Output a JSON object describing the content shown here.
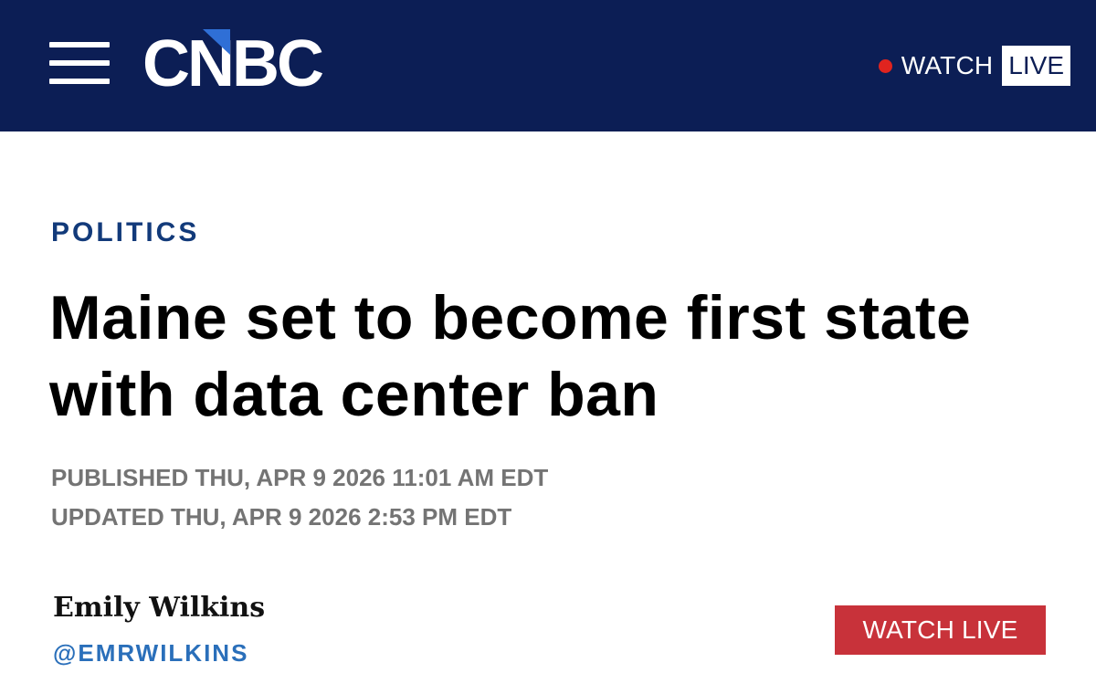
{
  "header": {
    "menu_icon": "hamburger-menu-icon",
    "logo_text": "CNBC",
    "watch_label": "WATCH",
    "live_label": "LIVE",
    "live_dot_color": "#e0241f",
    "background_color": "#0c1e55"
  },
  "article": {
    "section": "POLITICS",
    "headline": "Maine set to become first state with data center ban",
    "published": "PUBLISHED THU, APR 9 2026 11:01 AM EDT",
    "updated": "UPDATED THU, APR 9 2026 2:53 PM EDT"
  },
  "author": {
    "name": "Emily Wilkins",
    "handle": "@EMRWILKINS"
  },
  "cta": {
    "watch_live_label": "WATCH LIVE",
    "color": "#c8323a"
  }
}
